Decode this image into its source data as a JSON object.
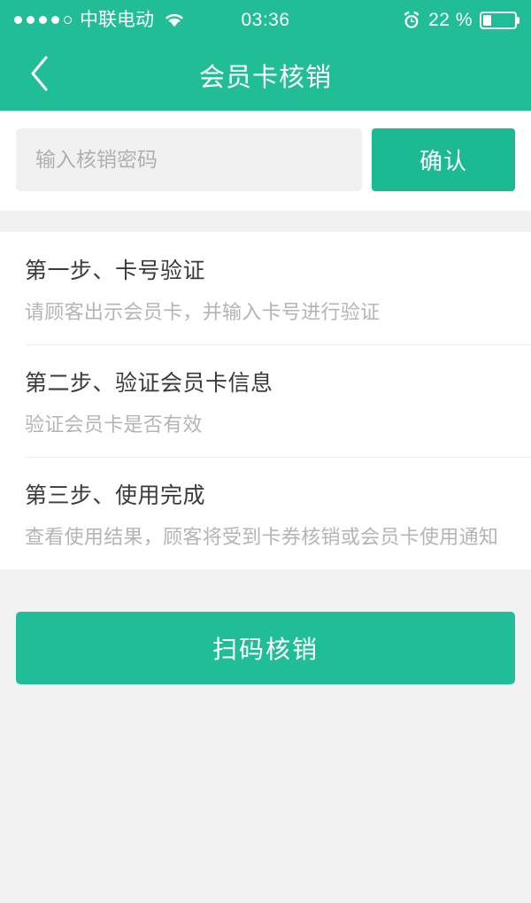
{
  "status_bar": {
    "signal_dots_total": 5,
    "signal_dots_filled": 4,
    "carrier": "中联电动",
    "wifi_icon": "wifi-icon",
    "time": "03:36",
    "alarm_icon": "alarm-clock-icon",
    "battery_percent": "22 %",
    "battery_level": 22
  },
  "nav": {
    "back_icon": "chevron-left-icon",
    "title": "会员卡核销"
  },
  "entry": {
    "input_value": "",
    "input_placeholder": "输入核销密码",
    "confirm_label": "确认"
  },
  "steps": [
    {
      "title": "第一步、卡号验证",
      "desc": "请顾客出示会员卡，并输入卡号进行验证"
    },
    {
      "title": "第二步、验证会员卡信息",
      "desc": "验证会员卡是否有效"
    },
    {
      "title": "第三步、使用完成",
      "desc": "查看使用结果，顾客将受到卡券核销或会员卡使用通知"
    }
  ],
  "bottom": {
    "scan_label": "扫码核销"
  },
  "colors": {
    "brand_green": "#21bd97",
    "button_green": "#1bba93",
    "page_bg": "#f2f2f2",
    "input_bg": "#f0f0f0",
    "title_text": "#3a3a3a",
    "muted_text": "#b4b4b4"
  }
}
